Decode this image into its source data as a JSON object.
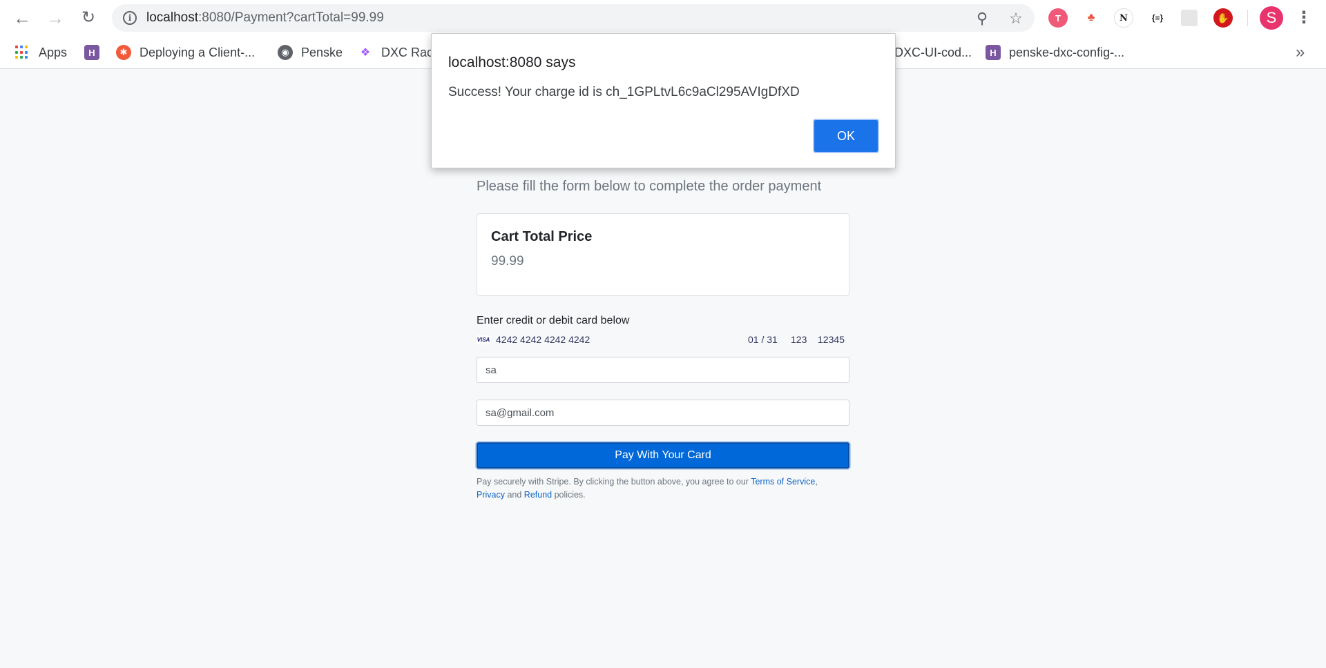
{
  "browser": {
    "url_host": "localhost",
    "url_path": ":8080/Payment?cartTotal=99.99",
    "profile_initial": "S"
  },
  "bookmarks": {
    "apps_label": "Apps",
    "items": [
      {
        "label": "Deploying a Client-..."
      },
      {
        "label": "Penske"
      },
      {
        "label": "DXC Raci"
      },
      {
        "label": "DXC-UI-cod..."
      },
      {
        "label": "penske-dxc-config-..."
      }
    ],
    "more": "»"
  },
  "page": {
    "subtitle": "Please fill the form below to complete the order payment",
    "cart": {
      "title": "Cart Total Price",
      "value": "99.99"
    },
    "card_label": "Enter credit or debit card below",
    "card_brand": "VISA",
    "card_number": "4242 4242 4242 4242",
    "card_expiry": "01 / 31",
    "card_cvc": "123",
    "card_zip": "12345",
    "name_value": "sa",
    "email_value": "sa@gmail.com",
    "pay_button": "Pay With Your Card",
    "legal": {
      "prefix": "Pay securely with Stripe. By clicking the button above, you agree to our ",
      "terms": "Terms of Service",
      "comma": ",",
      "privacy": "Privacy",
      "and": " and ",
      "refund": "Refund",
      "suffix": " policies."
    }
  },
  "dialog": {
    "title": "localhost:8080 says",
    "message": "Success! Your charge id is ch_1GPLtvL6c9aCl295AVIgDfXD",
    "ok_label": "OK"
  },
  "colors": {
    "accent": "#1a73e8",
    "pay_button": "#0068d9",
    "link": "#0b63c4"
  }
}
